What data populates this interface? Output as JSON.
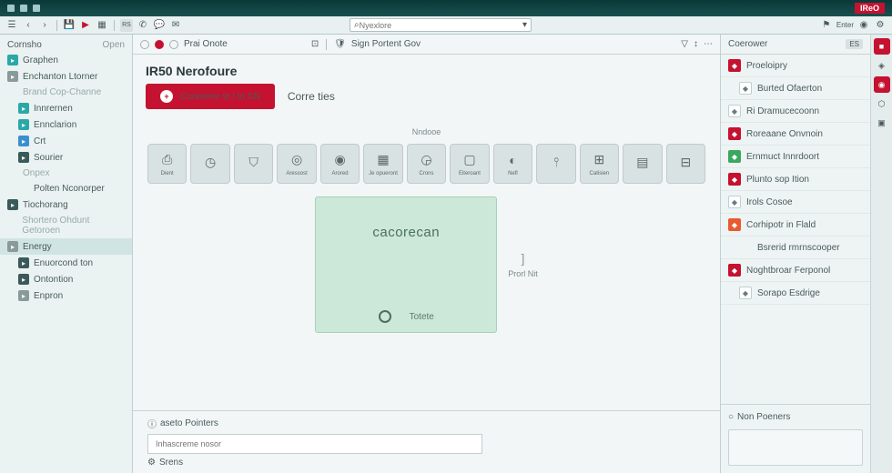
{
  "titlebar": {
    "logo_text": "IReO"
  },
  "toolbar": {
    "search_placeholder": "Nyexlore",
    "right_labels": [
      "Enter",
      ""
    ]
  },
  "sidebar": {
    "header": {
      "left": "Cornsho",
      "right": "Open"
    },
    "items": [
      {
        "label": "Graphen",
        "icon": "teal"
      },
      {
        "label": "Enchanton Ltorner",
        "icon": "gray"
      },
      {
        "label": "Brand Cop-Channe",
        "icon": "none",
        "faded": true
      },
      {
        "label": "Innrernen",
        "icon": "teal",
        "sub": true
      },
      {
        "label": "Ennclarion",
        "icon": "teal",
        "sub": true
      },
      {
        "label": "Crt",
        "icon": "blue",
        "sub": true
      },
      {
        "label": "Sourier",
        "icon": "dark",
        "sub": true
      },
      {
        "label": "Onpex",
        "icon": "none",
        "faded": true
      },
      {
        "label": "Polten Nconorper",
        "icon": "none",
        "sub": true
      },
      {
        "label": "Tiochorang",
        "icon": "dark"
      },
      {
        "label": "Shortero Ohdunt Getoroen",
        "icon": "none",
        "faded": true
      },
      {
        "label": "Energy",
        "icon": "gray",
        "sel": true
      },
      {
        "label": "Enuorcond ton",
        "icon": "dark",
        "sub": true
      },
      {
        "label": "Ontontion",
        "icon": "dark",
        "sub": true
      },
      {
        "label": "Enpron",
        "icon": "gray",
        "sub": true
      }
    ]
  },
  "main": {
    "tb_left": "Prai Onote",
    "tb_right": "Sign Portent Gov",
    "title": "IR50 Nerofoure",
    "cta_label": "Conoerne te l to SN",
    "cta_sub": "Corre ties",
    "canvas_label": "Nndooe",
    "tools": [
      {
        "label": "Dient",
        "icon": "camera"
      },
      {
        "label": "",
        "icon": "clock"
      },
      {
        "label": "",
        "icon": "shield"
      },
      {
        "label": "Aressost",
        "icon": "ring"
      },
      {
        "label": "Arored",
        "icon": "dot"
      },
      {
        "label": "Je opueront",
        "icon": "grid"
      },
      {
        "label": "Crons",
        "icon": "clock2"
      },
      {
        "label": "Eiteroant",
        "icon": "box"
      },
      {
        "label": "Nefl",
        "icon": "half"
      },
      {
        "label": "",
        "icon": "chart"
      },
      {
        "label": "Catisien",
        "icon": "window"
      },
      {
        "label": "",
        "icon": "page"
      },
      {
        "label": "",
        "icon": "grid2"
      }
    ],
    "canvas_text": "cacorecan",
    "canvas_footer": "Totete",
    "dim_right": "Prorl Nit",
    "bottom_meta": "aseto Pointers",
    "bottom_placeholder": "Inhascreme nosor",
    "bottom_footer": "Srens"
  },
  "rpanel": {
    "header": "Coerower",
    "header_btn": "ES",
    "items": [
      {
        "label": "Proeloipry",
        "icon": "red"
      },
      {
        "label": "Burted Ofaerton",
        "icon": "wht",
        "sub": true
      },
      {
        "label": "Ri Dramucecoonn",
        "icon": "wht"
      },
      {
        "label": "Roreaane Onvnoin",
        "icon": "red"
      },
      {
        "label": "Ernmuct Innrdoort",
        "icon": "grn"
      },
      {
        "label": "Plunto sop Ition",
        "icon": "red"
      },
      {
        "label": "Irols Cosoe",
        "icon": "wht"
      },
      {
        "label": "Corhipotr in Flald",
        "icon": "org"
      },
      {
        "label": "Bsrerid rmrnscooper",
        "icon": "none",
        "sub": true
      },
      {
        "label": "Noghtbroar Ferponol",
        "icon": "red"
      },
      {
        "label": "Sorapo Esdrige",
        "icon": "wht",
        "sub": true
      }
    ],
    "prop_label": "Non Poeners"
  }
}
